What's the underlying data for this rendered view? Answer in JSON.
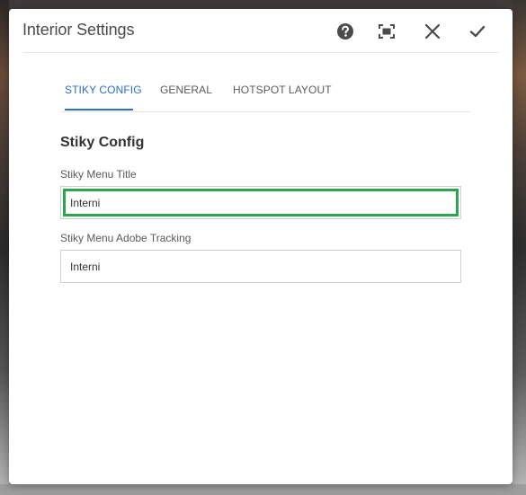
{
  "dialog": {
    "title": "Interior Settings",
    "header_icons": [
      "help-icon",
      "fullscreen-icon",
      "close-icon",
      "done-icon"
    ]
  },
  "tabs": [
    {
      "label": "STIKY CONFIG",
      "active": true
    },
    {
      "label": "GENERAL",
      "active": false
    },
    {
      "label": "HOTSPOT LAYOUT",
      "active": false
    }
  ],
  "section": {
    "title": "Stiky Config"
  },
  "fields": [
    {
      "label": "Stiky Menu Title",
      "value": "Interni",
      "focused": true
    },
    {
      "label": "Stiky Menu Adobe Tracking",
      "value": "Interni",
      "focused": false
    }
  ],
  "colors": {
    "accent": "#2d6ec9",
    "focus_ring": "#2da44e",
    "title_text": "#4b4b4b"
  }
}
